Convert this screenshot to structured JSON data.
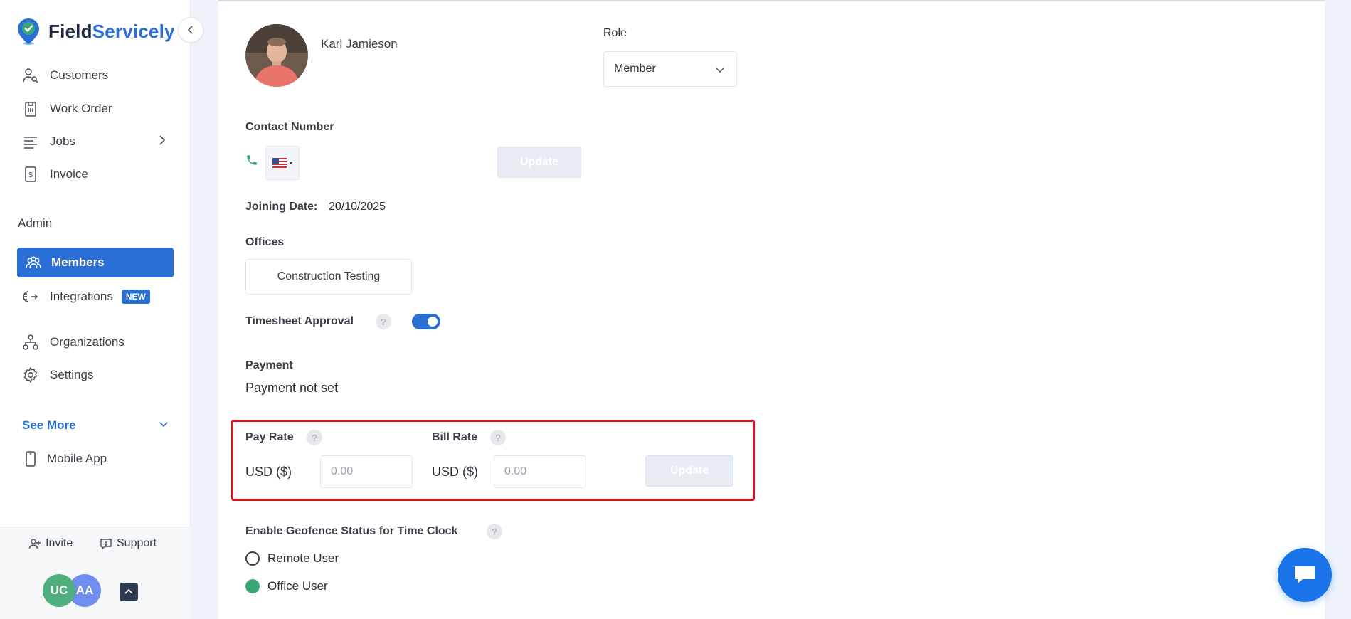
{
  "brand": {
    "name_part1": "Field",
    "name_part2": "Servicely"
  },
  "sidebar": {
    "items": [
      {
        "label": "Customers",
        "icon": "user-search-icon"
      },
      {
        "label": "Work Order",
        "icon": "clipboard-icon"
      },
      {
        "label": "Jobs",
        "icon": "list-icon"
      },
      {
        "label": "Invoice",
        "icon": "invoice-icon"
      }
    ],
    "admin_label": "Admin",
    "admin_items": [
      {
        "label": "Members",
        "icon": "users-icon",
        "active": true
      },
      {
        "label": "Integrations",
        "icon": "integrations-icon",
        "badge": "NEW"
      },
      {
        "label": "Organizations",
        "icon": "org-chart-icon"
      },
      {
        "label": "Settings",
        "icon": "gear-icon"
      }
    ],
    "see_more": "See More",
    "mobile_app": "Mobile App",
    "footer": {
      "invite": "Invite",
      "support": "Support",
      "avatars": [
        {
          "initials": "UC",
          "color": "#4caf7c"
        },
        {
          "initials": "AA",
          "color": "#6f8ef0"
        }
      ]
    }
  },
  "member": {
    "name": "Karl Jamieson",
    "role_label": "Role",
    "role_value": "Member",
    "contact_label": "Contact Number",
    "phone_value": "",
    "contact_update": "Update",
    "joining_label": "Joining Date:",
    "joining_value": "20/10/2025",
    "offices_label": "Offices",
    "office_chip": "Construction Testing",
    "timesheet_label": "Timesheet Approval",
    "timesheet_enabled": true,
    "payment_label": "Payment",
    "payment_value": "Payment not set",
    "pay_rate_label": "Pay Rate",
    "bill_rate_label": "Bill Rate",
    "currency": "USD ($)",
    "rate_placeholder": "0.00",
    "rate_update": "Update",
    "geofence_label": "Enable Geofence Status for Time Clock",
    "geofence_options": [
      {
        "label": "Remote User",
        "selected": false
      },
      {
        "label": "Office User",
        "selected": true
      }
    ]
  },
  "colors": {
    "accent": "#2a6fd6",
    "highlight": "#d9131e",
    "success": "#3aa872"
  }
}
